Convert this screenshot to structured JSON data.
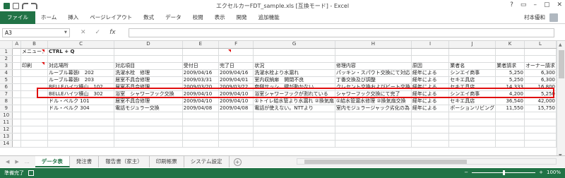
{
  "window": {
    "title": "エクセルカーFDT_sample.xls [互換モード] - Excel",
    "controls": [
      "?",
      "▭",
      "–",
      "▢",
      "✕"
    ]
  },
  "quick_access": {
    "icons": [
      "excel-icon",
      "save-icon",
      "undo-icon",
      "redo-icon"
    ]
  },
  "ribbon": {
    "tabs": [
      "ファイル",
      "ホーム",
      "挿入",
      "ページレイアウト",
      "数式",
      "データ",
      "校閲",
      "表示",
      "開発",
      "追加機能"
    ],
    "user": "村本優和"
  },
  "formula_bar": {
    "name_box": "A3",
    "cancel_icon": "✕",
    "enter_icon": "✓",
    "fx_label": "fx",
    "value": ""
  },
  "sheet": {
    "columns": [
      "A",
      "B",
      "C",
      "D",
      "E",
      "F",
      "G",
      "H",
      "I",
      "J",
      "K",
      "L"
    ],
    "rows": [
      {
        "n": "1",
        "cells": [
          "",
          "メニュー：",
          "CTRL + Q",
          "",
          "",
          "",
          "",
          "",
          "",
          "",
          "",
          ""
        ]
      },
      {
        "n": "2",
        "cells": [
          "",
          "",
          "",
          "",
          "",
          "",
          "",
          "",
          "",
          "",
          "",
          ""
        ]
      },
      {
        "n": "3",
        "cells": [
          "",
          "印刷",
          "対応場所",
          "対応項目",
          "受付日",
          "完了日",
          "状況",
          "修理内容",
          "原因",
          "業者名",
          "業者請求",
          "オーナー請求"
        ]
      },
      {
        "n": "4",
        "cells": [
          "",
          "",
          "ルーブル幕張Ⅰ　202",
          "洗濯水栓　修理",
          "2009/04/16",
          "2009/04/16",
          "洗濯水栓より水漏れ",
          "パッキン・スパウト交換にて対応",
          "経年による",
          "シンエイ商事",
          "5,250",
          "6,300"
        ]
      },
      {
        "n": "5",
        "cells": [
          "",
          "",
          "ルーブル幕張Ⅰ　203",
          "居室不具合修理",
          "2009/03/31",
          "2009/04/01",
          "室内収納扉　開閉不良",
          "丁番交換及び調整",
          "経年による",
          "セキエ具店",
          "5,250",
          "6,300"
        ]
      },
      {
        "n": "6",
        "cells": [
          "",
          "",
          "BELLEハイツ横山　102",
          "居室不具合修理",
          "2009/03/20",
          "2009/03/22",
          "南側サッシ、鍵が動かない",
          "クレセント交換およびビート交換",
          "経年による",
          "セキエ具店",
          "14,333",
          "16,800"
        ]
      },
      {
        "n": "7",
        "cells": [
          "",
          "",
          "BELLEハイツ横山　302",
          "浴室　シャワーフック交換",
          "2009/04/10",
          "2009/04/10",
          "浴室シャワーフックが割れている",
          "シャワーフック交換にて完了",
          "経年による",
          "シンエイ商事",
          "4,200",
          "5,250"
        ]
      },
      {
        "n": "8",
        "cells": [
          "",
          "",
          "ドル・ベルク 101",
          "居室不具合修理",
          "2009/04/10",
          "2009/04/10",
          "①トイレ給水管より水漏れ ②換気扇",
          "①給水管漏水修理 ②換気扇交換",
          "経年による",
          "セキエ具店",
          "36,540",
          "42,000"
        ]
      },
      {
        "n": "9",
        "cells": [
          "",
          "",
          "ドル・ベルク 304",
          "電話モジュラー交換",
          "2009/04/08",
          "2009/04/08",
          "電話が使えない。NTTより",
          "室内モジュラージャック劣化の為",
          "経年による",
          "ポーションリビング",
          "11,550",
          "15,750"
        ]
      },
      {
        "n": "10",
        "cells": [
          "",
          "",
          "",
          "",
          "",
          "",
          "",
          "",
          "",
          "",
          "",
          ""
        ]
      },
      {
        "n": "11",
        "cells": [
          "",
          "",
          "",
          "",
          "",
          "",
          "",
          "",
          "",
          "",
          "",
          ""
        ]
      },
      {
        "n": "12",
        "cells": [
          "",
          "",
          "",
          "",
          "",
          "",
          "",
          "",
          "",
          "",
          "",
          ""
        ]
      },
      {
        "n": "13",
        "cells": [
          "",
          "",
          "",
          "",
          "",
          "",
          "",
          "",
          "",
          "",
          "",
          ""
        ]
      },
      {
        "n": "14",
        "cells": [
          "",
          "",
          "",
          "",
          "",
          "",
          "",
          "",
          "",
          "",
          "",
          ""
        ]
      }
    ]
  },
  "sheet_tabs": {
    "tabs": [
      "データ表",
      "発注書",
      "報告書（家主）",
      "印刷帳票",
      "システム設定"
    ],
    "active": "データ表",
    "nav": [
      "◀",
      "▶",
      "…"
    ]
  },
  "status_bar": {
    "ready": "準備完了",
    "zoom": "100%",
    "minus": "−",
    "plus": "+"
  },
  "colors": {
    "excel_green": "#217346",
    "highlight_red": "#e01010"
  }
}
